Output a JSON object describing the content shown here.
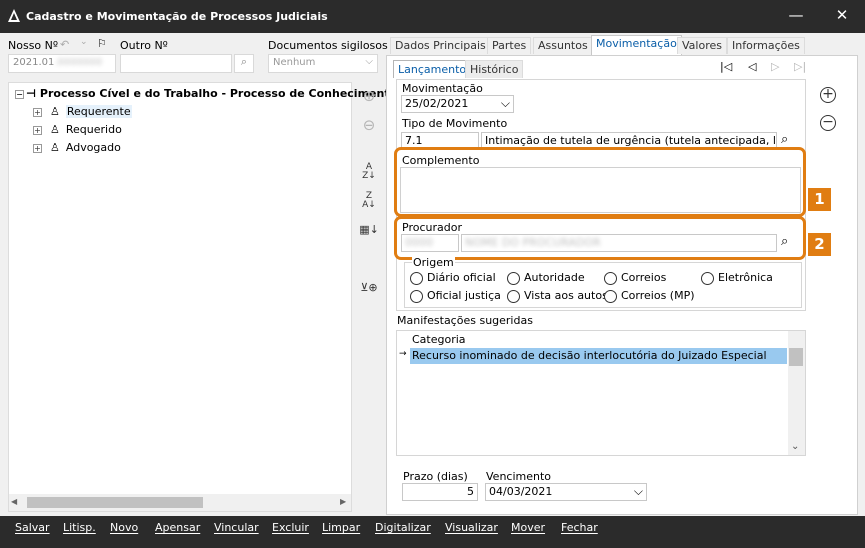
{
  "window": {
    "title": "Cadastro e Movimentação de Processos Judiciais",
    "controls": {
      "minimize": "—",
      "close": "✕"
    }
  },
  "header": {
    "nosso_label": "Nosso Nº",
    "nosso_value": "2021.01",
    "outro_label": "Outro Nº",
    "outro_value": "",
    "docs_label": "Documentos sigilosos",
    "docs_value": "Nenhum"
  },
  "tree": {
    "root": "Processo Cível e do Trabalho - Processo de Conhecimento",
    "items": [
      {
        "label": "Requerente"
      },
      {
        "label": "Requerido"
      },
      {
        "label": "Advogado"
      }
    ]
  },
  "tabs": [
    "Dados Principais",
    "Partes",
    "Assuntos",
    "Movimentação",
    "Valores",
    "Informações"
  ],
  "subtabs": [
    "Lançamento",
    "Histórico"
  ],
  "form": {
    "movimentacao_label": "Movimentação",
    "movimentacao_value": "25/02/2021",
    "tipo_label": "Tipo de Movimento",
    "tipo_code": "7.1",
    "tipo_desc": "Intimação de tutela de urgência (tutela antecipada, limina",
    "complemento_label": "Complemento",
    "procurador_label": "Procurador",
    "origem_label": "Origem",
    "origem_options": [
      "Diário oficial",
      "Autoridade",
      "Correios",
      "Eletrônica",
      "Oficial justiça",
      "Vista aos autos",
      "Correios (MP)"
    ],
    "manifestacoes_label": "Manifestações sugeridas",
    "grid_header": "Categoria",
    "grid_row_marker": "→",
    "grid_row": "Recurso inominado de decisão interlocutória do Juizado Especial",
    "prazo_label": "Prazo (dias)",
    "prazo_value": "5",
    "vencimento_label": "Vencimento",
    "vencimento_value": "04/03/2021"
  },
  "badges": [
    "1",
    "2"
  ],
  "bottom_buttons": [
    "Salvar",
    "Litisp.",
    "Novo",
    "Apensar",
    "Vincular",
    "Excluir",
    "Limpar",
    "Digitalizar",
    "Visualizar",
    "Mover",
    "Fechar"
  ],
  "colors": {
    "accent": "#e07d12",
    "link": "#0a5ea8",
    "selection": "#99c9ef",
    "titlebar": "#2b2b2b"
  }
}
